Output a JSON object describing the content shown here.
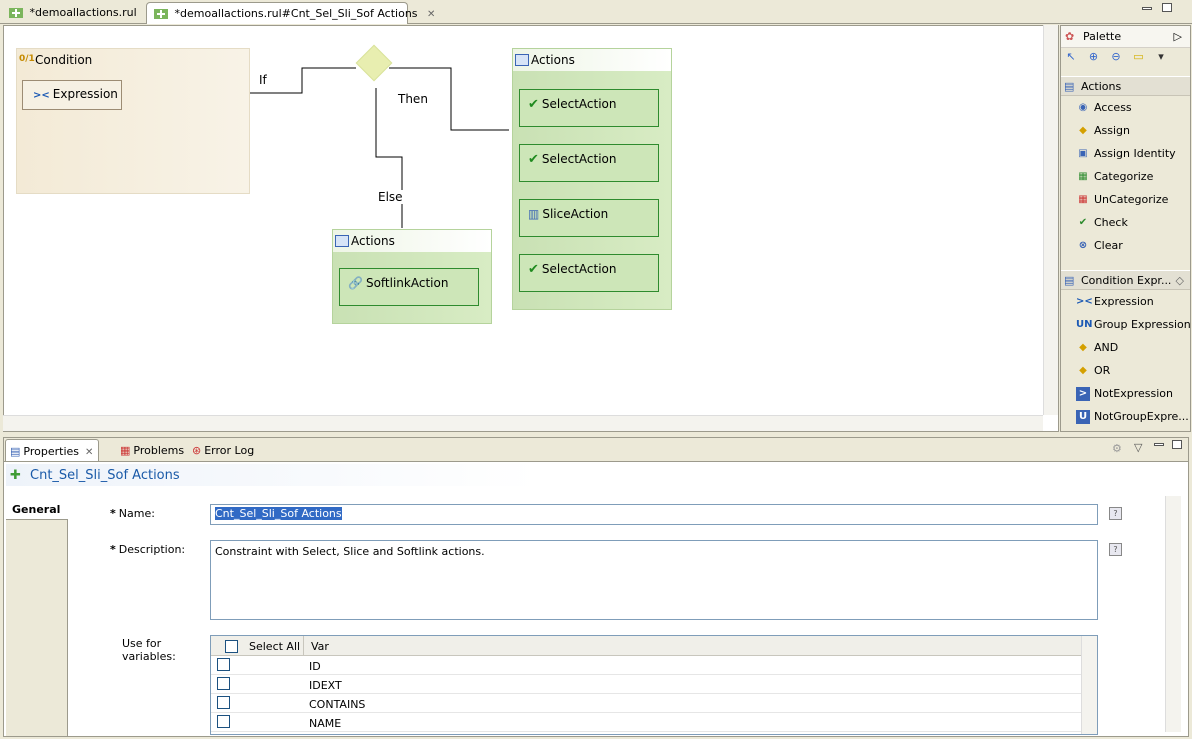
{
  "tabs": [
    {
      "label": "*demoallactions.rul"
    },
    {
      "label": "*demoallactions.rul#Cnt_Sel_Sli_Sof Actions"
    }
  ],
  "diagram": {
    "condition": {
      "title": "Condition",
      "expression": "Expression"
    },
    "labels": {
      "if": "If",
      "then": "Then",
      "else": "Else"
    },
    "then_actions": {
      "title": "Actions",
      "items": [
        "SelectAction",
        "SelectAction",
        "SliceAction",
        "SelectAction"
      ]
    },
    "else_actions": {
      "title": "Actions",
      "items": [
        "SoftlinkAction"
      ]
    }
  },
  "palette": {
    "title": "Palette",
    "actions_section": "Actions",
    "actions": [
      "Access",
      "Assign",
      "Assign Identity",
      "Categorize",
      "UnCategorize",
      "Check",
      "Clear"
    ],
    "condition_section": "Condition Expr...",
    "conditions": [
      "Expression",
      "Group Expression",
      "AND",
      "OR",
      "NotExpression",
      "NotGroupExpre..."
    ]
  },
  "bottom_tabs": [
    "Properties",
    "Problems",
    "Error Log"
  ],
  "properties": {
    "title": "Cnt_Sel_Sli_Sof Actions",
    "general_tab": "General",
    "name_label": "Name:",
    "name_value": "Cnt_Sel_Sli_Sof Actions",
    "desc_label": "Description:",
    "desc_value": "Constraint with Select, Slice and Softlink actions.",
    "use_for_label_1": "Use for",
    "use_for_label_2": "variables:",
    "table": {
      "select_all": "Select All",
      "var_header": "Var",
      "rows": [
        "ID",
        "IDEXT",
        "CONTAINS",
        "NAME"
      ]
    }
  },
  "colors": {
    "accent": "#1a5aa8",
    "action_green": "#2e8b2e",
    "condition_bg": "#f3ead6"
  }
}
